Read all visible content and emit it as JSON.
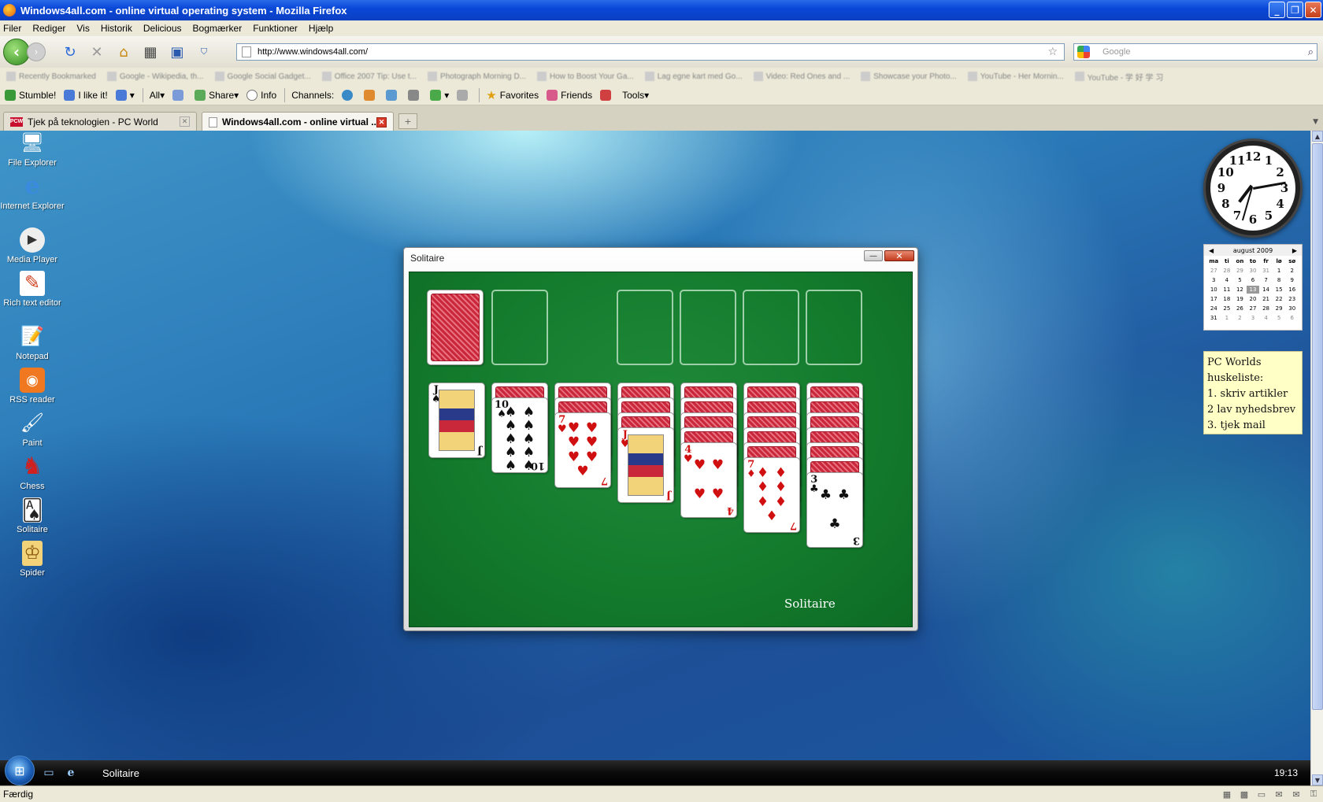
{
  "browser": {
    "title": "Windows4all.com - online virtual operating system - Mozilla Firefox",
    "menu": [
      "Filer",
      "Rediger",
      "Vis",
      "Historik",
      "Delicious",
      "Bogmærker",
      "Funktioner",
      "Hjælp"
    ],
    "url": "http://www.windows4all.com/",
    "search_placeholder": "Google",
    "bookmarks": [
      "Recently Bookmarked",
      "Google - Wikipedia, th...",
      "Google Social Gadget...",
      "Office 2007 Tip: Use t...",
      "Photograph Morning D...",
      "How to Boost Your Ga...",
      "Lag egne kart med Go...",
      "Video: Red Ones and ...",
      "Showcase your Photo...",
      "YouTube - Her Mornin...",
      "YouTube - 学 好 学 习"
    ],
    "stumble": {
      "stumble": "Stumble!",
      "like": "I like it!",
      "all": "All",
      "share": "Share",
      "info": "Info",
      "channels": "Channels:",
      "favorites": "Favorites",
      "friends": "Friends",
      "tools": "Tools"
    },
    "tabs": [
      {
        "label": "Tjek på teknologien - PC World",
        "favicon": "PCW"
      },
      {
        "label": "Windows4all.com - online virtual ..."
      }
    ],
    "new_tab": "+",
    "status": "Færdig",
    "window_buttons": {
      "min": "_",
      "max": "❐",
      "close": "✕"
    }
  },
  "desktop": {
    "icons": [
      {
        "label": "File Explorer",
        "icon": "computer-icon",
        "glyph": "🖥"
      },
      {
        "label": "Internet Explorer",
        "icon": "ie-icon",
        "glyph": "e"
      },
      {
        "label": "Media Player",
        "icon": "media-player-icon",
        "glyph": "▶"
      },
      {
        "label": "Rich text editor",
        "icon": "pen-icon",
        "glyph": "✎"
      },
      {
        "label": "Notepad",
        "icon": "notepad-icon",
        "glyph": "📝"
      },
      {
        "label": "RSS reader",
        "icon": "rss-icon",
        "glyph": "◉"
      },
      {
        "label": "Paint",
        "icon": "paint-icon",
        "glyph": "🖌"
      },
      {
        "label": "Chess",
        "icon": "chess-knight-icon",
        "glyph": "♞"
      },
      {
        "label": "Solitaire",
        "icon": "card-icon",
        "glyph": "🂡"
      },
      {
        "label": "Spider",
        "icon": "spider-card-icon",
        "glyph": "♔"
      }
    ],
    "clock_numbers": [
      "12",
      "1",
      "2",
      "3",
      "4",
      "5",
      "6",
      "7",
      "8",
      "9",
      "10",
      "11"
    ],
    "calendar": {
      "month": "august 2009",
      "prev": "◀",
      "next": "▶",
      "weekdays": [
        "ma",
        "ti",
        "on",
        "to",
        "fr",
        "lø",
        "sø"
      ],
      "days": [
        [
          "27",
          "28",
          "29",
          "30",
          "31",
          "1",
          "2"
        ],
        [
          "3",
          "4",
          "5",
          "6",
          "7",
          "8",
          "9"
        ],
        [
          "10",
          "11",
          "12",
          "13",
          "14",
          "15",
          "16"
        ],
        [
          "17",
          "18",
          "19",
          "20",
          "21",
          "22",
          "23"
        ],
        [
          "24",
          "25",
          "26",
          "27",
          "28",
          "29",
          "30"
        ],
        [
          "31",
          "1",
          "2",
          "3",
          "4",
          "5",
          "6"
        ]
      ],
      "today": "13"
    },
    "note": {
      "title1": "PC Worlds",
      "title2": "huskeliste:",
      "items": [
        "1. skriv artikler",
        "2 lav nyhedsbrev",
        "3. tjek mail"
      ]
    }
  },
  "solitaire": {
    "title": "Solitaire",
    "brand": "Solitaire",
    "min": "—",
    "close": "✕",
    "tableau": [
      {
        "hidden": 0,
        "rank": "J",
        "suit": "♠",
        "color": "black"
      },
      {
        "hidden": 1,
        "rank": "10",
        "suit": "♠",
        "color": "black"
      },
      {
        "hidden": 2,
        "rank": "7",
        "suit": "♥",
        "color": "red"
      },
      {
        "hidden": 3,
        "rank": "J",
        "suit": "♥",
        "color": "red"
      },
      {
        "hidden": 4,
        "rank": "4",
        "suit": "♥",
        "color": "red"
      },
      {
        "hidden": 5,
        "rank": "7",
        "suit": "♦",
        "color": "red"
      },
      {
        "hidden": 6,
        "rank": "3",
        "suit": "♣",
        "color": "black"
      }
    ]
  },
  "taskbar": {
    "task": "Solitaire",
    "time": "19:13"
  }
}
